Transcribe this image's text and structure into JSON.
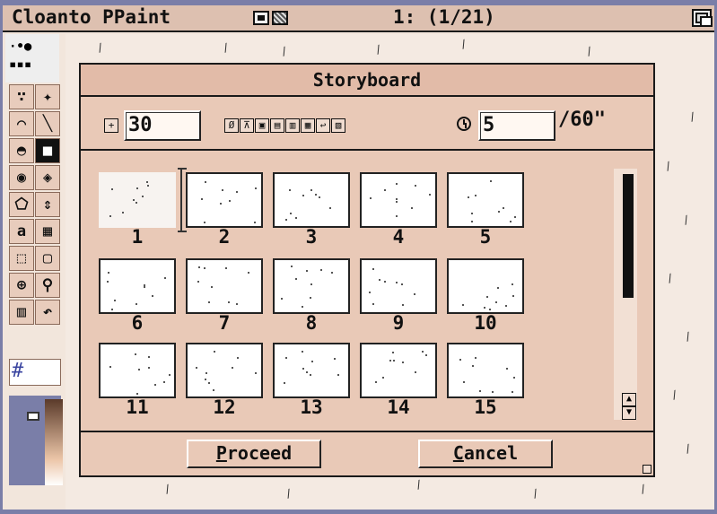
{
  "app": {
    "title": "Cloanto PPaint",
    "frame_counter": "1: (1/21)"
  },
  "dialog": {
    "title": "Storyboard",
    "frames_per_row_value": "30",
    "delay_value": "5",
    "delay_unit": "/60\"",
    "frames": [
      "1",
      "2",
      "3",
      "4",
      "5",
      "6",
      "7",
      "8",
      "9",
      "10",
      "11",
      "12",
      "13",
      "14",
      "15"
    ],
    "proceed_label": "Proceed",
    "cancel_label": "Cancel"
  },
  "colors": {
    "background": "#7a7ea8",
    "dialog": "#e9c9b7",
    "titlebar": "#ddc0b0",
    "screen": "#f2e6dc"
  }
}
